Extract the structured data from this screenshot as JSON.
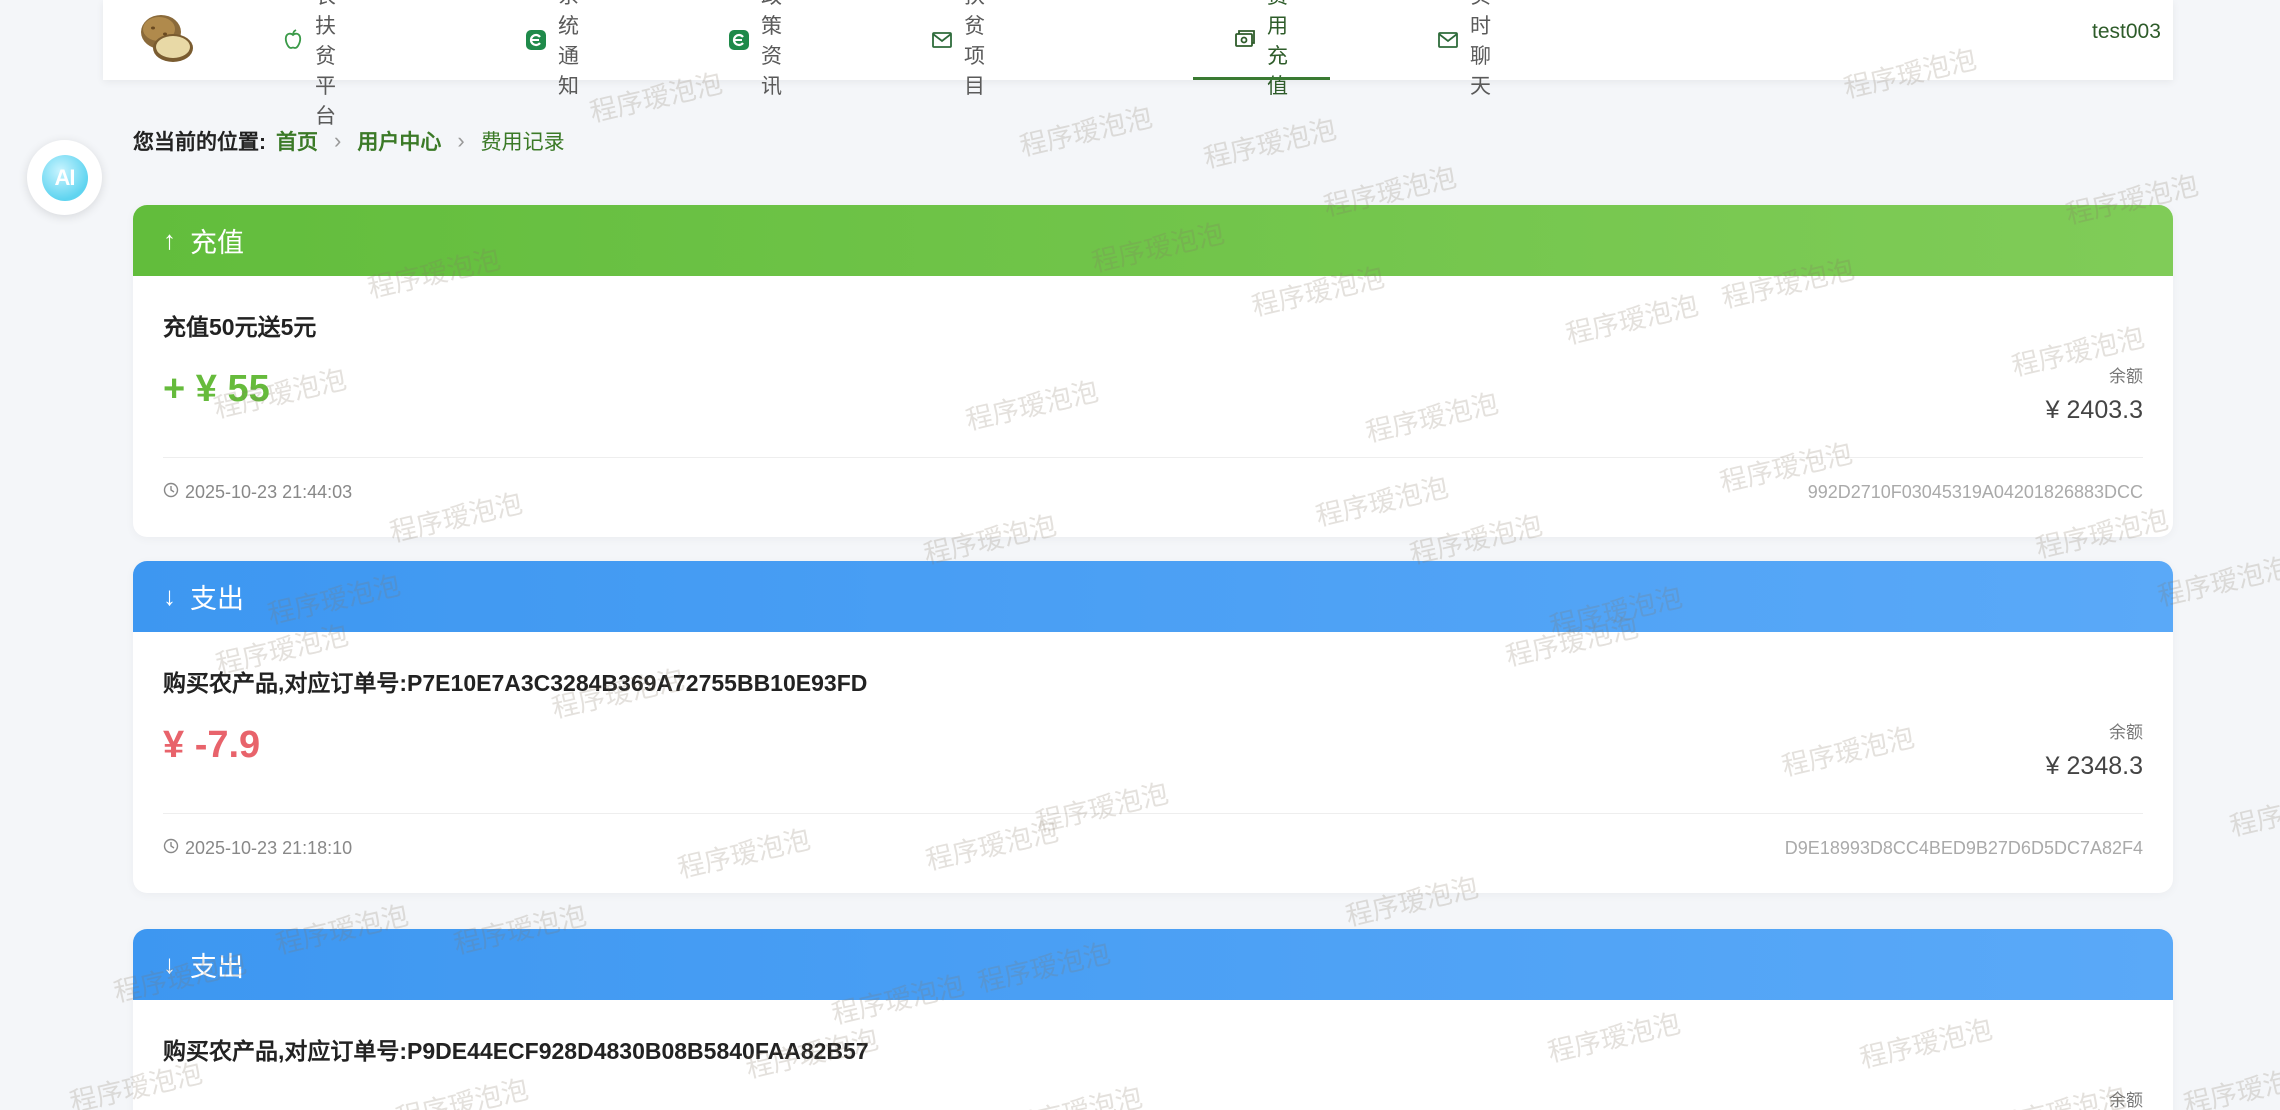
{
  "nav": {
    "items": [
      {
        "label": "助农扶贫平台",
        "icon": "apple-icon"
      },
      {
        "label": "系统通知",
        "icon": "notice-icon"
      },
      {
        "label": "政策资讯",
        "icon": "news-icon"
      },
      {
        "label": "扶贫项目",
        "icon": "mail-icon"
      },
      {
        "label": "费用充值",
        "icon": "wallet-icon"
      },
      {
        "label": "实时聊天",
        "icon": "chat-icon"
      }
    ],
    "active_index": 4,
    "user": "test003"
  },
  "ai_button": {
    "label": "AI"
  },
  "breadcrumb": {
    "prefix": "您当前的位置:",
    "home": "首页",
    "user_center": "用户中心",
    "current": "费用记录"
  },
  "records": [
    {
      "kind": "income",
      "type_label": "充值",
      "title": "充值50元送5元",
      "amount": "+ ¥ 55",
      "balance_label": "余额",
      "balance": "¥ 2403.3",
      "time": "2025-10-23 21:44:03",
      "code": "992D2710F03045319A04201826883DCC"
    },
    {
      "kind": "expense",
      "type_label": "支出",
      "title": "购买农产品,对应订单号:P7E10E7A3C3284B369A72755BB10E93FD",
      "amount": "¥ -7.9",
      "balance_label": "余额",
      "balance": "¥ 2348.3",
      "time": "2025-10-23 21:18:10",
      "code": "D9E18993D8CC4BED9B27D6D5DC7A82F4"
    },
    {
      "kind": "expense",
      "type_label": "支出",
      "title": "购买农产品,对应订单号:P9DE44ECF928D4830B08B5840FAA82B57",
      "amount": "",
      "balance_label": "余额",
      "balance": "",
      "time": "",
      "code": ""
    }
  ],
  "watermark": "程序瑷泡泡",
  "colors": {
    "income": "#62bd3c",
    "expense": "#3d97f1",
    "plus_amount": "#66bb3c",
    "minus_amount": "#e8636b",
    "accent_green": "#2e5c2a"
  }
}
